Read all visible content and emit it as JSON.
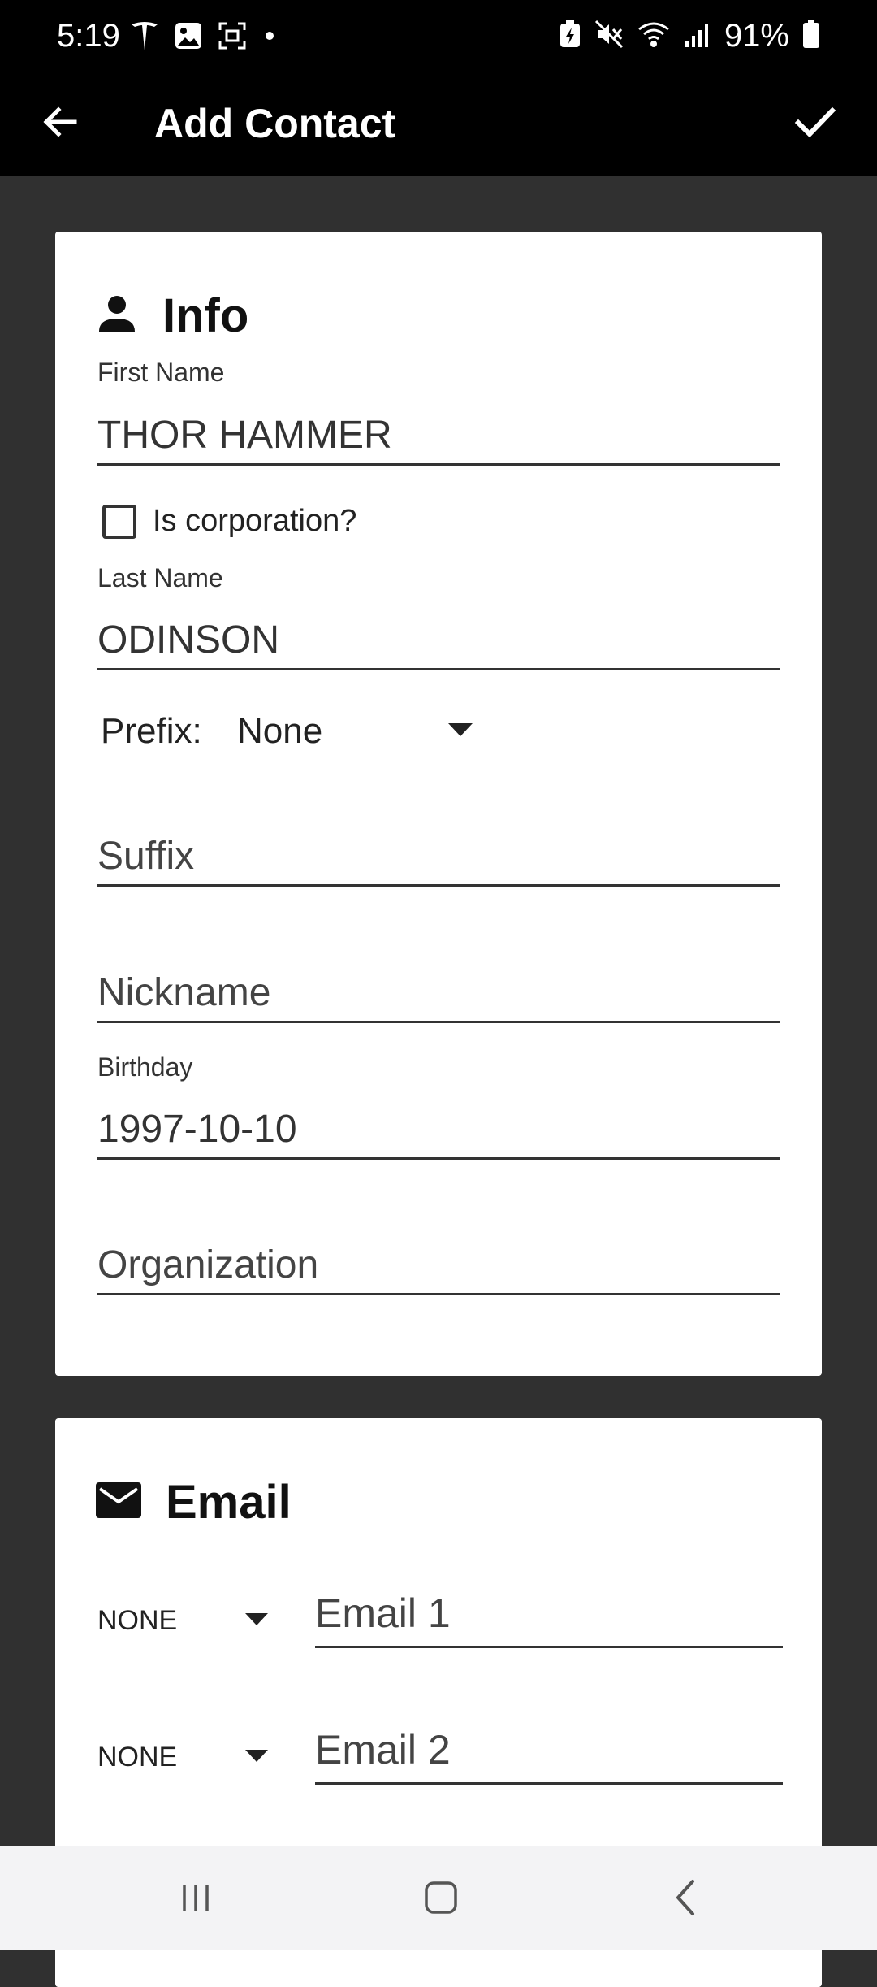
{
  "status_bar": {
    "time": "5:19",
    "battery": "91%",
    "left_icons": [
      "tesla-icon",
      "image-icon",
      "screenshot-icon",
      "dot-icon"
    ],
    "right_icons": [
      "battery-saver-icon",
      "mute-icon",
      "wifi-icon",
      "signal-icon",
      "battery-icon"
    ]
  },
  "app_bar": {
    "title": "Add Contact",
    "back_icon": "arrow-left-icon",
    "confirm_icon": "check-icon"
  },
  "info": {
    "title": "Info",
    "icon": "person-icon",
    "first_name": {
      "label": "First Name",
      "value": "THOR HAMMER"
    },
    "is_corporation": {
      "label": "Is corporation?",
      "checked": false
    },
    "last_name": {
      "label": "Last Name",
      "value": "ODINSON"
    },
    "prefix": {
      "label": "Prefix:",
      "value": "None"
    },
    "suffix": {
      "placeholder": "Suffix",
      "value": ""
    },
    "nickname": {
      "placeholder": "Nickname",
      "value": ""
    },
    "birthday": {
      "label": "Birthday",
      "value": "1997-10-10"
    },
    "organization": {
      "placeholder": "Organization",
      "value": ""
    }
  },
  "email": {
    "title": "Email",
    "icon": "mail-icon",
    "rows": [
      {
        "type": "NONE",
        "placeholder": "Email 1",
        "value": ""
      },
      {
        "type": "NONE",
        "placeholder": "Email 2",
        "value": ""
      }
    ]
  },
  "nav_bar": {
    "icons": [
      "recent-apps-icon",
      "home-icon",
      "back-icon"
    ]
  },
  "colors": {
    "background": "#303030",
    "bar": "#000000",
    "card": "#ffffff",
    "nav": "#f3f3f5"
  }
}
